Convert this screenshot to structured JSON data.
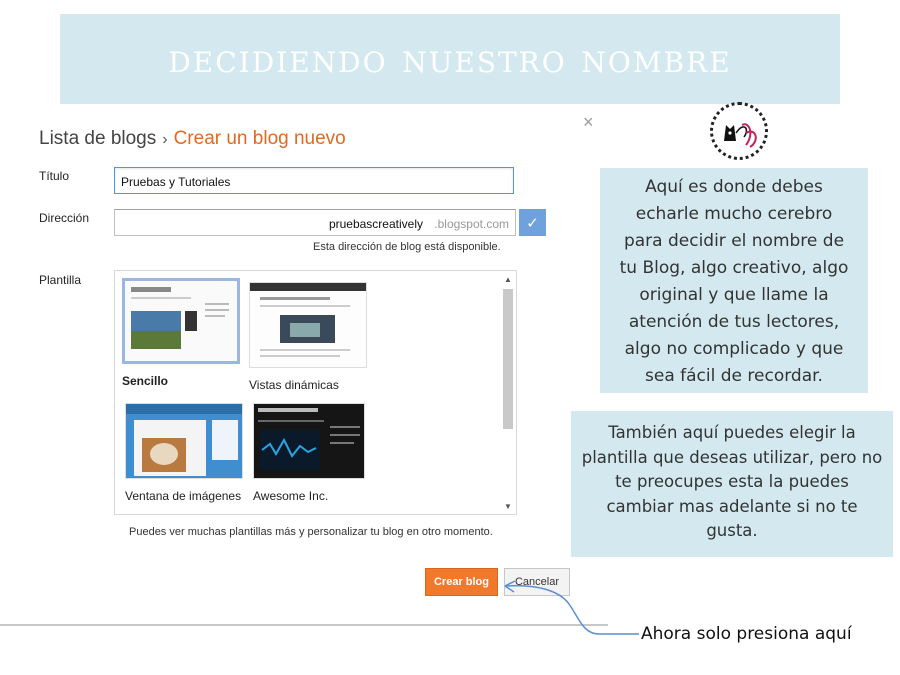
{
  "banner": {
    "title": "Decidiendo nuestro nombre"
  },
  "breadcrumb": {
    "parent": "Lista de blogs",
    "separator": "›",
    "current": "Crear un blog nuevo"
  },
  "dialog": {
    "close_glyph": "×"
  },
  "logo": {
    "icon": "cat-logo-icon"
  },
  "form": {
    "title_label": "Título",
    "title_value": "Pruebas y Tutoriales",
    "address_label": "Dirección",
    "address_value": "pruebascreatively",
    "address_suffix": ".blogspot.com",
    "address_status": "Esta dirección de blog está disponible.",
    "template_label": "Plantilla",
    "templates": [
      {
        "name": "Sencillo",
        "selected": true
      },
      {
        "name": "Vistas dinámicas",
        "selected": false
      },
      {
        "name": "Ventana de imágenes",
        "selected": false
      },
      {
        "name": "Awesome Inc.",
        "selected": false
      }
    ],
    "template_hint": "Puedes ver muchas plantillas más y personalizar tu blog en otro momento."
  },
  "buttons": {
    "create": "Crear blog",
    "cancel": "Cancelar"
  },
  "notes": {
    "first": "Aquí es donde debes echarle mucho cerebro para decidir el nombre de tu Blog, algo creativo, algo original y que llame la atención de tus lectores, algo no complicado y que sea fácil de recordar.",
    "second": "También aquí puedes elegir la plantilla que deseas utilizar, pero no te preocupes esta la puedes cambiar mas adelante si no te gusta.",
    "arrow_label": "Ahora solo presiona aquí"
  },
  "colors": {
    "accent": "#e2691f",
    "button": "#f0792c",
    "note_bg": "#d3e9ef",
    "check": "#6fa2dd"
  }
}
